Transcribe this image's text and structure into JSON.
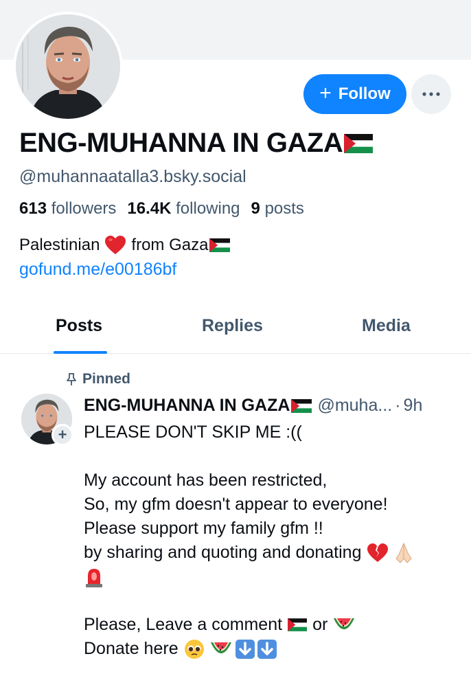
{
  "profile": {
    "display_name": "ENG-MUHANNA IN GAZA",
    "handle": "@muhannaatalla3.bsky.social",
    "followers_count": "613",
    "followers_label": "followers",
    "following_count": "16.4K",
    "following_label": "following",
    "posts_count": "9",
    "posts_label": "posts",
    "bio_text": "Palestinian",
    "bio_text2": "from Gaza",
    "bio_link": "gofund.me/e00186bf",
    "follow_label": "Follow"
  },
  "tabs": [
    {
      "label": "Posts",
      "active": true
    },
    {
      "label": "Replies",
      "active": false
    },
    {
      "label": "Media",
      "active": false
    }
  ],
  "post": {
    "pinned_label": "Pinned",
    "author_name": "ENG-MUHANNA IN GAZA",
    "author_handle": "@muha...",
    "separator": "·",
    "time": "9h",
    "line1": "PLEASE DON'T SKIP ME :((",
    "line2": "My account has been restricted,",
    "line3": "So, my gfm doesn't appear to everyone!",
    "line4": "Please support my family gfm !!",
    "line5": "by sharing and quoting and donating",
    "line6a": "Please, Leave a comment",
    "line6b": "or",
    "line7": "Donate here"
  },
  "colors": {
    "accent": "#1083fe",
    "secondary_text": "#42576c",
    "banner": "#f1f3f5"
  }
}
